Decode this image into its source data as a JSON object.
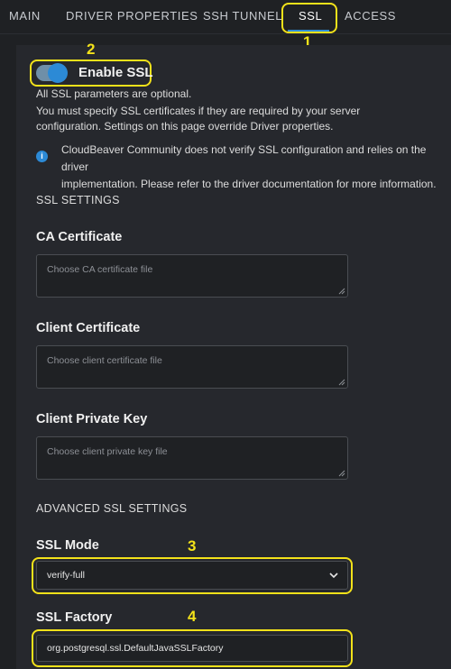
{
  "tabs": [
    {
      "label": "MAIN"
    },
    {
      "label": "DRIVER PROPERTIES"
    },
    {
      "label": "SSH TUNNEL"
    },
    {
      "label": "SSL"
    },
    {
      "label": "ACCESS"
    }
  ],
  "annotations": [
    "1",
    "2",
    "3",
    "4"
  ],
  "ssl": {
    "enable_label": "Enable SSL",
    "enabled": true,
    "intro_line1": "All SSL parameters are optional.",
    "intro_line2": "You must specify SSL certificates if they are required by your server",
    "intro_line3": "configuration. Settings on this page override Driver properties.",
    "info_icon": "info-icon",
    "info_line1": "CloudBeaver Community does not verify SSL configuration and relies on the driver",
    "info_line2": "implementation. Please refer to the driver documentation for more information."
  },
  "ssl_settings": {
    "title": "SSL SETTINGS",
    "ca_label": "CA Certificate",
    "ca_placeholder": "Choose CA certificate file",
    "client_cert_label": "Client Certificate",
    "client_cert_placeholder": "Choose client certificate file",
    "client_key_label": "Client Private Key",
    "client_key_placeholder": "Choose client private key file"
  },
  "advanced": {
    "title": "ADVANCED SSL SETTINGS",
    "mode_label": "SSL Mode",
    "mode_value": "verify-full",
    "factory_label": "SSL Factory",
    "factory_value": "org.postgresql.ssl.DefaultJavaSSLFactory"
  },
  "colors": {
    "accent": "#2c8ad6",
    "annotation": "#f3e21a",
    "background": "#1f2124",
    "panel": "#26282d"
  }
}
